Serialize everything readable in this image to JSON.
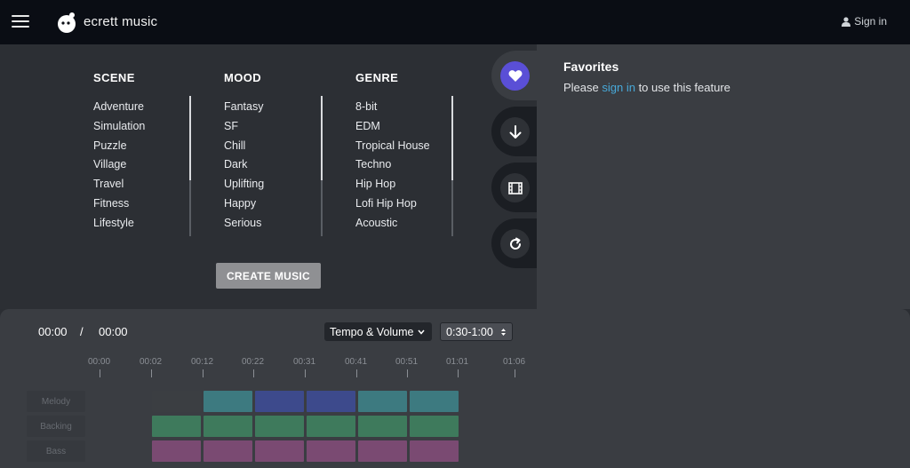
{
  "app": {
    "name": "ecrett music",
    "signin_label": "Sign in"
  },
  "categories": {
    "scene": {
      "title": "SCENE",
      "items": [
        "Adventure",
        "Simulation",
        "Puzzle",
        "Village",
        "Travel",
        "Fitness",
        "Lifestyle"
      ]
    },
    "mood": {
      "title": "MOOD",
      "items": [
        "Fantasy",
        "SF",
        "Chill",
        "Dark",
        "Uplifting",
        "Happy",
        "Serious"
      ]
    },
    "genre": {
      "title": "GENRE",
      "items": [
        "8-bit",
        "EDM",
        "Tropical House",
        "Techno",
        "Hip Hop",
        "Lofi Hip Hop",
        "Acoustic"
      ]
    }
  },
  "create_button": "CREATE MUSIC",
  "side_tabs": [
    {
      "icon": "heart-icon",
      "active": true
    },
    {
      "icon": "download-icon",
      "active": false
    },
    {
      "icon": "film-icon",
      "active": false
    },
    {
      "icon": "refresh-icon",
      "active": false
    }
  ],
  "favorites": {
    "title": "Favorites",
    "message_before": "Please ",
    "link": "sign in",
    "message_after": " to use this feature"
  },
  "player": {
    "current_time": "00:00",
    "separator": "/",
    "total_time": "00:00",
    "mode_select": "Tempo & Volume",
    "range_select": "0:30-1:00",
    "timeline": [
      "00:00",
      "00:02",
      "00:12",
      "00:22",
      "00:31",
      "00:41",
      "00:51",
      "01:01",
      "01:06"
    ],
    "tracks": [
      {
        "name": "Melody",
        "colors": [
          "#3b3e42",
          "#3d7a80",
          "#3d4a8c",
          "#3d4a8c",
          "#3d7a80",
          "#3d7a80"
        ]
      },
      {
        "name": "Backing",
        "colors": [
          "#3e7a5c",
          "#3e7a5c",
          "#3e7a5c",
          "#3e7a5c",
          "#3e7a5c",
          "#3e7a5c"
        ]
      },
      {
        "name": "Bass",
        "colors": [
          "#7a4a72",
          "#7a4a72",
          "#7a4a72",
          "#7a4a72",
          "#7a4a72",
          "#7a4a72"
        ]
      }
    ]
  },
  "colors": {
    "accent": "#5a4fd6",
    "link": "#47a9d9",
    "topbar": "#0a0d14"
  }
}
